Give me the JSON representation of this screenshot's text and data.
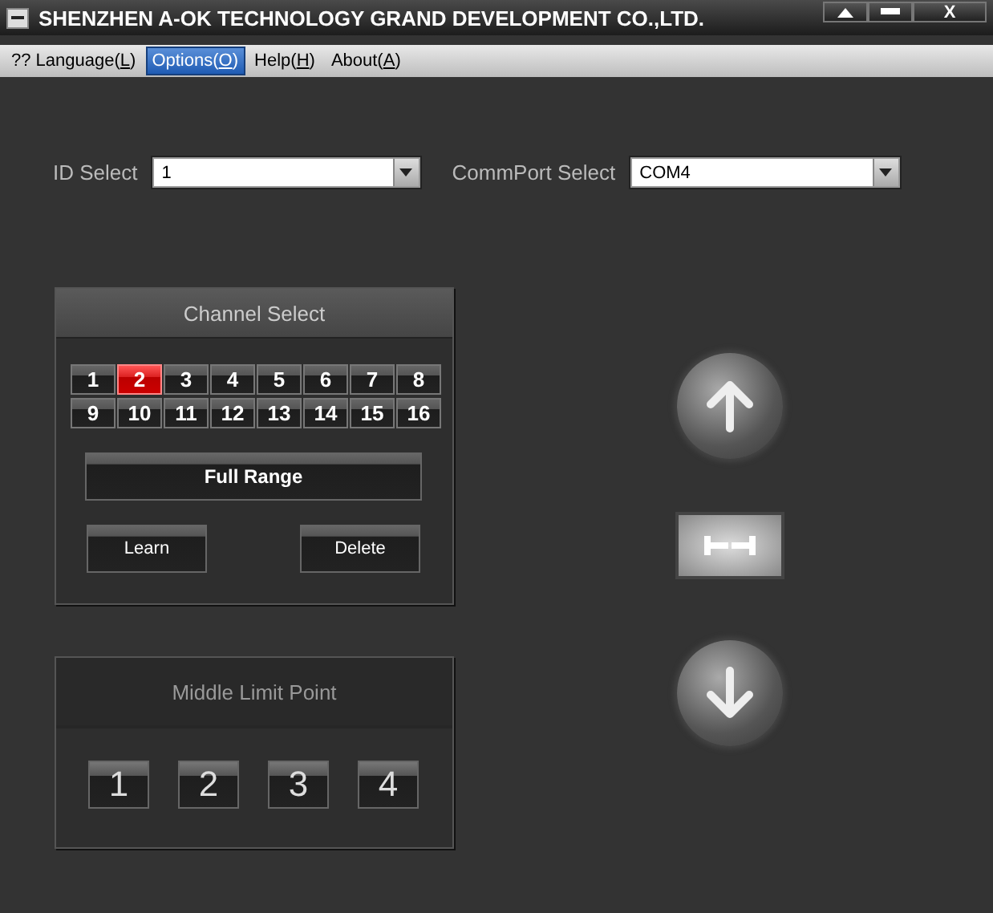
{
  "window": {
    "title": "SHENZHEN A-OK TECHNOLOGY GRAND DEVELOPMENT CO.,LTD.",
    "close_label": "X"
  },
  "menu": [
    {
      "prefix": "?? Language(",
      "accelerator": "L",
      "suffix": ")",
      "selected": false
    },
    {
      "prefix": "Options(",
      "accelerator": "O",
      "suffix": ")",
      "selected": true
    },
    {
      "prefix": "Help(",
      "accelerator": "H",
      "suffix": ")",
      "selected": false
    },
    {
      "prefix": "About(",
      "accelerator": "A",
      "suffix": ")",
      "selected": false
    }
  ],
  "selects": [
    {
      "label": "ID Select",
      "value": "1"
    },
    {
      "label": "CommPort Select",
      "value": "COM4"
    }
  ],
  "channel_panel": {
    "title": "Channel Select",
    "channels": [
      {
        "label": "1",
        "selected": false
      },
      {
        "label": "2",
        "selected": true
      },
      {
        "label": "3",
        "selected": false
      },
      {
        "label": "4",
        "selected": false
      },
      {
        "label": "5",
        "selected": false
      },
      {
        "label": "6",
        "selected": false
      },
      {
        "label": "7",
        "selected": false
      },
      {
        "label": "8",
        "selected": false
      },
      {
        "label": "9",
        "selected": false
      },
      {
        "label": "10",
        "selected": false
      },
      {
        "label": "11",
        "selected": false
      },
      {
        "label": "12",
        "selected": false
      },
      {
        "label": "13",
        "selected": false
      },
      {
        "label": "14",
        "selected": false
      },
      {
        "label": "15",
        "selected": false
      },
      {
        "label": "16",
        "selected": false
      }
    ],
    "full_range": "Full Range",
    "learn": "Learn",
    "delete": "Delete"
  },
  "limit_panel": {
    "title": "Middle Limit Point",
    "points": [
      "1",
      "2",
      "3",
      "4"
    ]
  }
}
